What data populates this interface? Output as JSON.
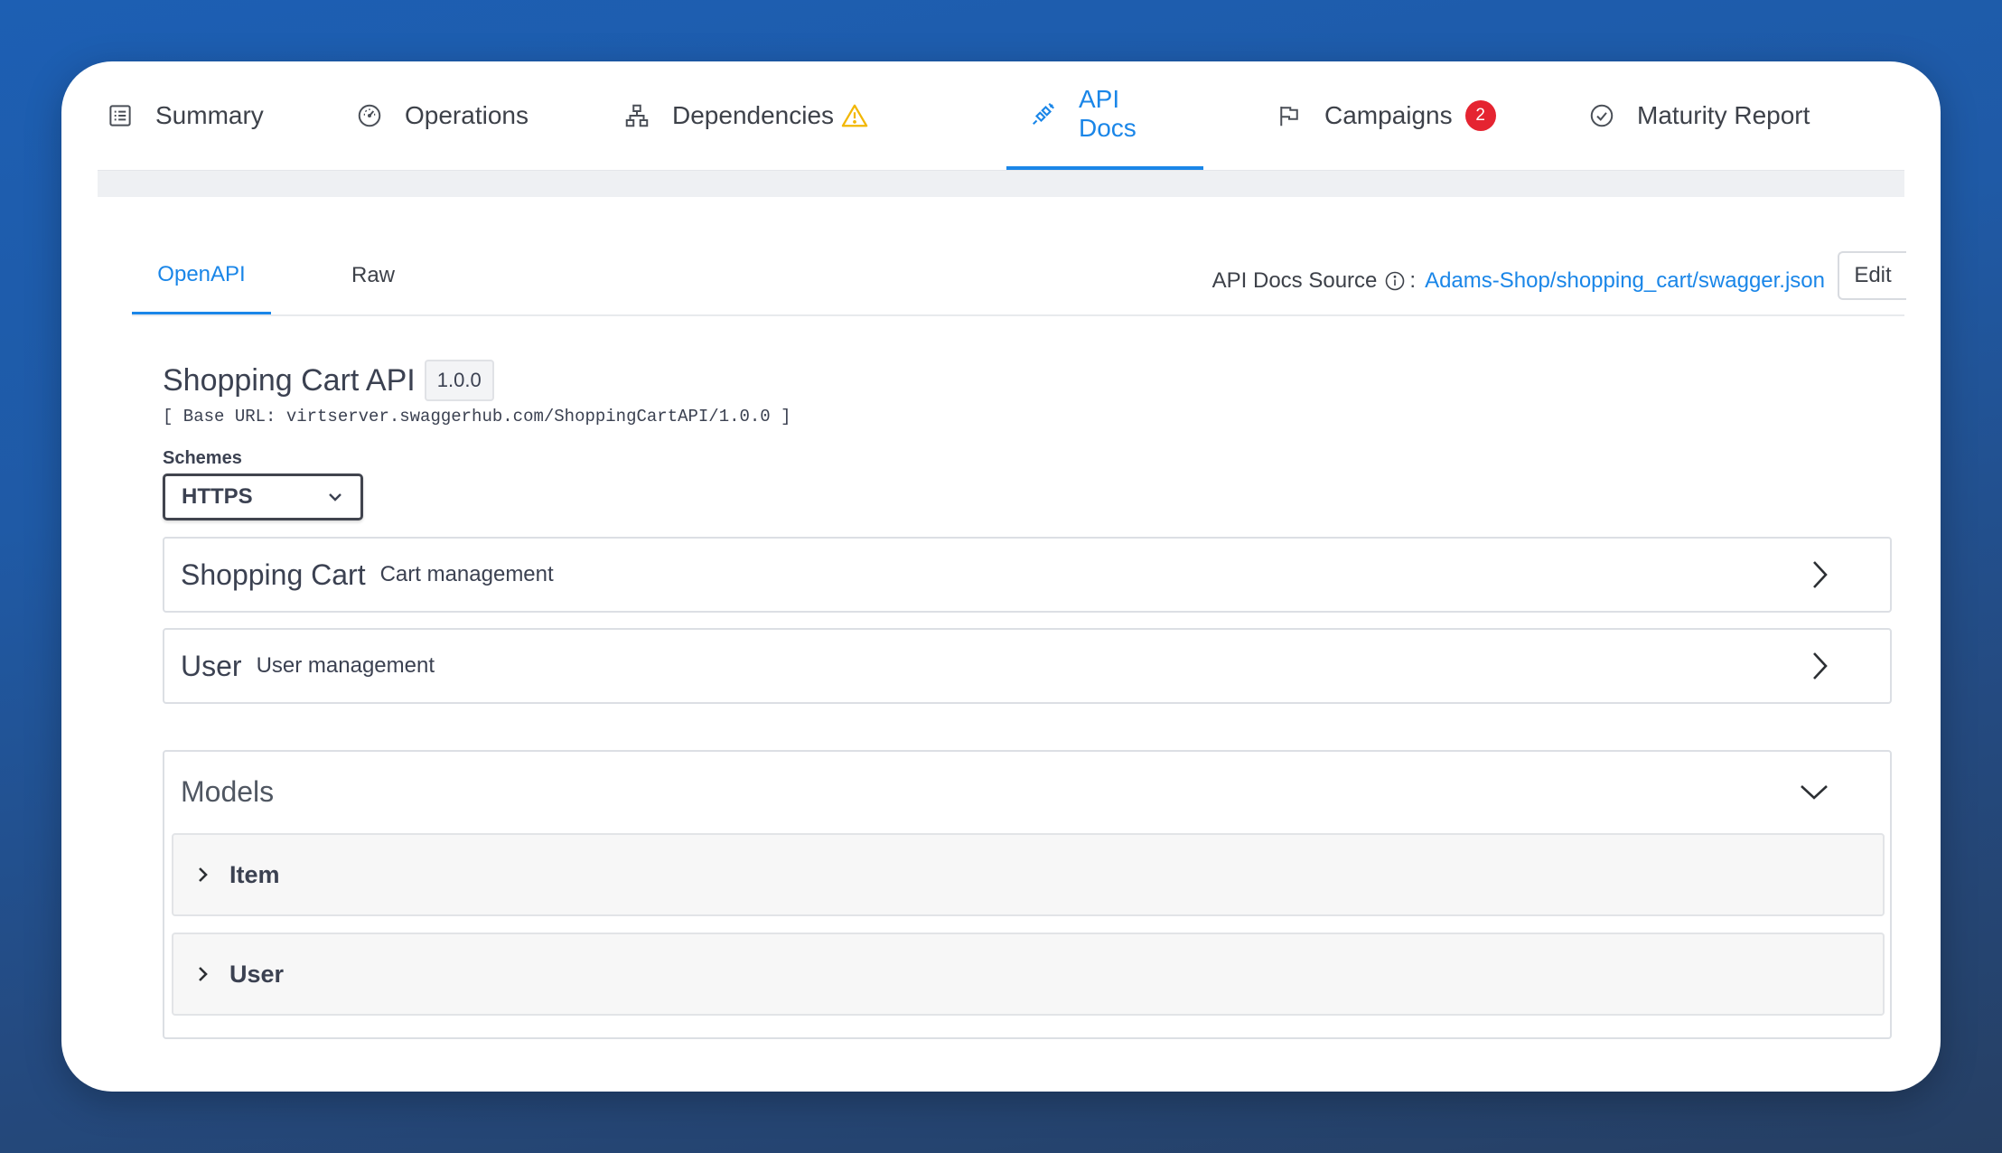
{
  "top_tabs": [
    {
      "label": "Summary",
      "icon": "list-icon"
    },
    {
      "label": "Operations",
      "icon": "gauge-icon"
    },
    {
      "label": "Dependencies",
      "icon": "hierarchy-icon",
      "warning": true
    },
    {
      "label": "API Docs",
      "icon": "plug-icon",
      "active": true
    },
    {
      "label": "Campaigns",
      "icon": "flag-icon",
      "badge": "2"
    },
    {
      "label": "Maturity Report",
      "icon": "check-circle-icon"
    }
  ],
  "sub_tabs": [
    {
      "label": "OpenAPI",
      "active": true
    },
    {
      "label": "Raw"
    }
  ],
  "source": {
    "label": "API Docs Source",
    "separator": ":",
    "link": "Adams-Shop/shopping_cart/swagger.json",
    "edit_label": "Edit"
  },
  "api": {
    "title": "Shopping Cart API",
    "version": "1.0.0",
    "base_url": "[ Base URL: virtserver.swaggerhub.com/ShoppingCartAPI/1.0.0 ]",
    "schemes_label": "Schemes",
    "scheme_selected": "HTTPS"
  },
  "tags": [
    {
      "name": "Shopping Cart",
      "description": "Cart management"
    },
    {
      "name": "User",
      "description": "User management"
    }
  ],
  "models": {
    "title": "Models",
    "items": [
      {
        "name": "Item"
      },
      {
        "name": "User"
      }
    ]
  },
  "colors": {
    "accent": "#1a86e8",
    "badge": "#e52431",
    "warning": "#f2b705"
  }
}
